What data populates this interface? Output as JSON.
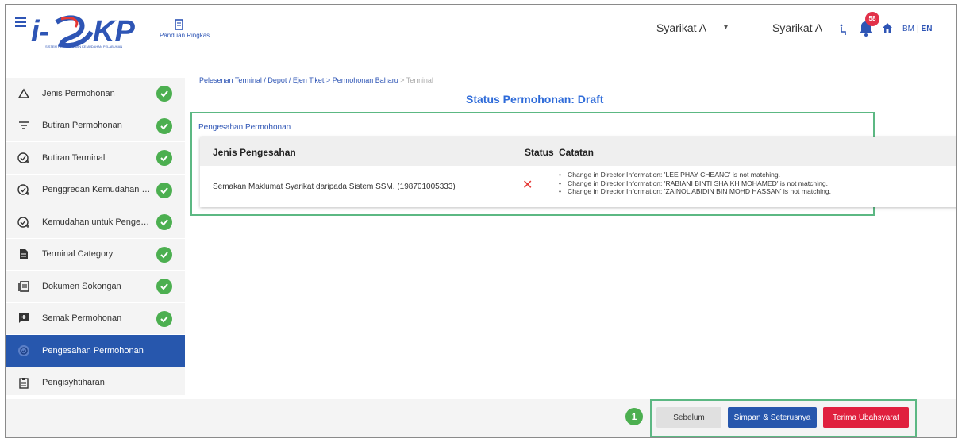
{
  "header": {
    "brand": "i-SPKP",
    "brand_subtitle": "SISTEM PERMOHONAN KEMUDAHAN PELABUHAN",
    "guide_label": "Panduan Ringkas",
    "company_selector": "Syarikat A",
    "company_name": "Syarikat A",
    "notification_count": "58",
    "lang_bm": "BM",
    "lang_sep": "|",
    "lang_en": "EN"
  },
  "sidebar": {
    "items": [
      {
        "label": "Jenis Permohonan",
        "icon": "triangle-icon",
        "done": true
      },
      {
        "label": "Butiran Permohonan",
        "icon": "filter-icon",
        "done": true
      },
      {
        "label": "Butiran Terminal",
        "icon": "check-plus-icon",
        "done": true
      },
      {
        "label": "Penggredan Kemudahan Pen...",
        "icon": "check-plus-icon",
        "done": true
      },
      {
        "label": "Kemudahan untuk Pengendali...",
        "icon": "check-plus-icon",
        "done": true
      },
      {
        "label": "Terminal Category",
        "icon": "document-icon",
        "done": true
      },
      {
        "label": "Dokumen Sokongan",
        "icon": "documents-icon",
        "done": true
      },
      {
        "label": "Semak Permohonan",
        "icon": "add-box-icon",
        "done": true
      },
      {
        "label": "Pengesahan Permohonan",
        "icon": "verify-icon",
        "done": false,
        "active": true
      },
      {
        "label": "Pengisyhtiharan",
        "icon": "clipboard-icon",
        "done": false
      }
    ]
  },
  "breadcrumb": {
    "part1": "Pelesenan Terminal / Depot / Ejen Tiket",
    "sep1": ">",
    "part2": "Permohonan Baharu",
    "sep2": ">",
    "part3": "Terminal"
  },
  "page_title": "Status Permohonan: Draft",
  "panel": {
    "title": "Pengesahan Permohonan",
    "columns": [
      "Jenis Pengesahan",
      "Status",
      "Catatan"
    ],
    "rows": [
      {
        "type": "Semakan Maklumat Syarikat daripada Sistem SSM. (198701005333)",
        "status": "✕",
        "notes": [
          "Change in Director Information: 'LEE PHAY CHEANG' is not matching.",
          "Change in Director Information: 'RABIANI BINTI SHAIKH MOHAMED' is not matching.",
          "Change in Director Information: 'ZAINOL ABIDIN BIN MOHD HASSAN' is not matching."
        ]
      }
    ]
  },
  "footer": {
    "step_number": "1",
    "prev_label": "Sebelum",
    "save_label": "Simpan & Seterusnya",
    "accept_label": "Terima Ubahsyarat"
  },
  "colors": {
    "primary": "#2757ad",
    "success": "#4caf50",
    "danger": "#e0203e",
    "highlight_box": "#5cb883"
  }
}
